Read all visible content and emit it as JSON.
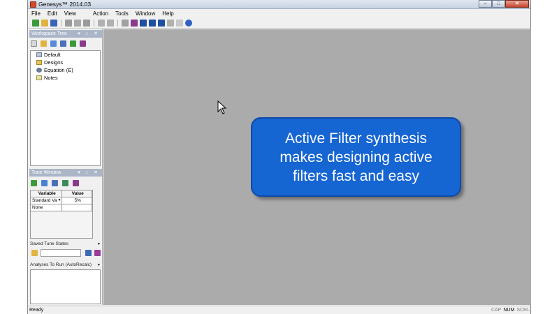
{
  "window": {
    "title": "Genesys™ 2014.03",
    "min": "–",
    "max": "□",
    "close": "✕"
  },
  "menu": [
    "File",
    "Edit",
    "View",
    "Action",
    "Tools",
    "Window",
    "Help"
  ],
  "workspace_tree": {
    "title": "Workspace Tree",
    "controls": "▾ ↕ ✕",
    "items": [
      "Default",
      "Designs",
      "Equation (E)",
      "Notes"
    ]
  },
  "tune_window": {
    "title": "Tune Window",
    "controls": "▾ ↕ ✕",
    "col_variable": "Variable",
    "col_value": "Value",
    "row1_variable": "Standard Va",
    "row1_value": "5%",
    "row2_variable": "None"
  },
  "saved_tune_states": {
    "label": "Saved Tune States"
  },
  "analyses": {
    "label": "Analyses To Run (AutoRecalc)"
  },
  "callout": {
    "line1": "Active Filter synthesis",
    "line2": "makes designing active",
    "line3": "filters fast and easy"
  },
  "status": {
    "ready": "Ready",
    "cap": "CAP",
    "num": "NUM",
    "scrl": "SCRL"
  }
}
